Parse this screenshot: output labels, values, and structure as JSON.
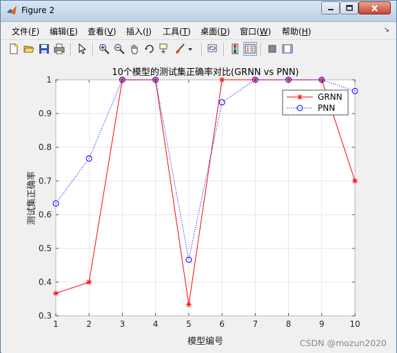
{
  "window": {
    "title": "Figure 2",
    "controls": {
      "minimize": "minimize",
      "maximize": "maximize",
      "close": "close"
    }
  },
  "menubar": {
    "items": [
      {
        "label": "文件(",
        "key": "F",
        "end": ")"
      },
      {
        "label": "编辑(",
        "key": "E",
        "end": ")"
      },
      {
        "label": "查看(",
        "key": "V",
        "end": ")"
      },
      {
        "label": "插入(",
        "key": "I",
        "end": ")"
      },
      {
        "label": "工具(",
        "key": "T",
        "end": ")"
      },
      {
        "label": "桌面(",
        "key": "D",
        "end": ")"
      },
      {
        "label": "窗口(",
        "key": "W",
        "end": ")"
      },
      {
        "label": "帮助(",
        "key": "H",
        "end": ")"
      }
    ]
  },
  "toolbar": {
    "icons": [
      "new-figure-icon",
      "open-file-icon",
      "save-icon",
      "print-icon",
      "select-arrow-icon",
      "zoom-in-icon",
      "zoom-out-icon",
      "pan-hand-icon",
      "rotate-3d-icon",
      "data-cursor-icon",
      "brush-icon",
      "brush-dropdown-icon",
      "link-plot-icon",
      "colorbar-icon",
      "legend-icon",
      "hide-plot-tools-icon",
      "show-plot-tools-icon"
    ]
  },
  "watermark": "CSDN @mozun2020",
  "chart_data": {
    "type": "line",
    "title": "10个模型的测试集正确率对比(GRNN vs PNN)",
    "xlabel": "模型编号",
    "ylabel": "测试集正确率",
    "xlim": [
      1,
      10
    ],
    "ylim": [
      0.3,
      1
    ],
    "x": [
      1,
      2,
      3,
      4,
      5,
      6,
      7,
      8,
      9,
      10
    ],
    "xticks": [
      "1",
      "2",
      "3",
      "4",
      "5",
      "6",
      "7",
      "8",
      "9",
      "10"
    ],
    "yticks": [
      "0.3",
      "0.4",
      "0.5",
      "0.6",
      "0.7",
      "0.8",
      "0.9",
      "1"
    ],
    "grid": true,
    "legend_position": "top-right",
    "series": [
      {
        "name": "GRNN",
        "color": "#ff0000",
        "marker": "star",
        "line": "solid",
        "values": [
          0.3667,
          0.4,
          1,
          1,
          0.3333,
          1,
          1,
          1,
          1,
          0.7
        ]
      },
      {
        "name": "PNN",
        "color": "#0000ff",
        "marker": "circle",
        "line": "dotted",
        "values": [
          0.6333,
          0.7667,
          1,
          1,
          0.4667,
          0.9333,
          1,
          1,
          1,
          0.9667
        ]
      }
    ]
  }
}
